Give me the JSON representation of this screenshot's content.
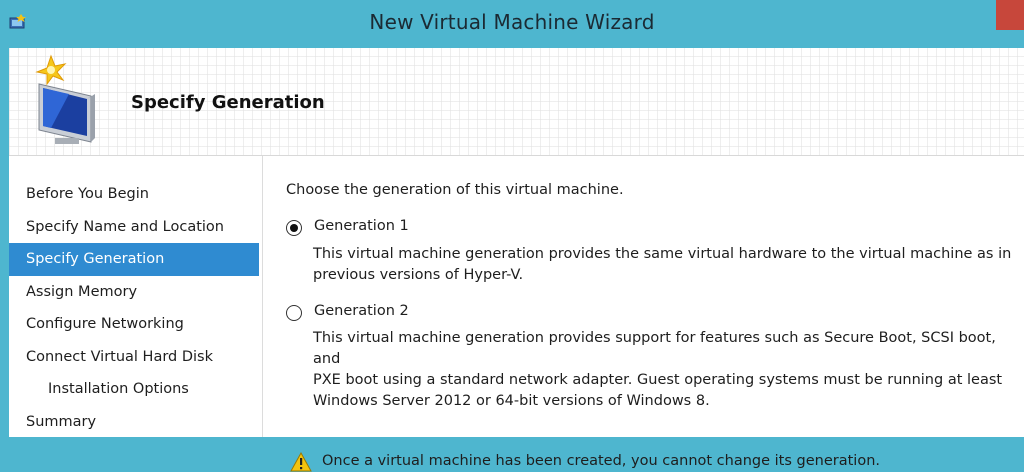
{
  "window": {
    "title": "New Virtual Machine Wizard"
  },
  "header": {
    "page_title": "Specify Generation"
  },
  "sidebar": {
    "items": [
      {
        "label": "Before You Begin"
      },
      {
        "label": "Specify Name and Location"
      },
      {
        "label": "Specify Generation"
      },
      {
        "label": "Assign Memory"
      },
      {
        "label": "Configure Networking"
      },
      {
        "label": "Connect Virtual Hard Disk"
      },
      {
        "label": "Installation Options"
      },
      {
        "label": "Summary"
      }
    ],
    "active_index": 2
  },
  "content": {
    "prompt": "Choose the generation of this virtual machine.",
    "options": [
      {
        "label": "Generation 1",
        "selected": true,
        "description_lines": [
          "This virtual machine generation provides the same virtual hardware to the virtual machine as in",
          "previous versions of Hyper-V."
        ]
      },
      {
        "label": "Generation 2",
        "selected": false,
        "description_lines": [
          "This virtual machine generation provides support for features such as Secure Boot, SCSI boot, and",
          "PXE boot using a standard network adapter. Guest operating systems must be running at least",
          "Windows Server 2012 or 64-bit versions of Windows 8."
        ]
      }
    ],
    "warning": "Once a virtual machine has been created, you cannot change its generation."
  },
  "colors": {
    "titlebar": "#4eb6cf",
    "selection": "#2f8bd1",
    "close_button": "#c7473b",
    "warning": "#f2c40f"
  },
  "icons": {
    "app": "hyperv-app-icon",
    "wizard": "new-vm-wizard-icon",
    "warning": "warning-triangle-icon"
  }
}
